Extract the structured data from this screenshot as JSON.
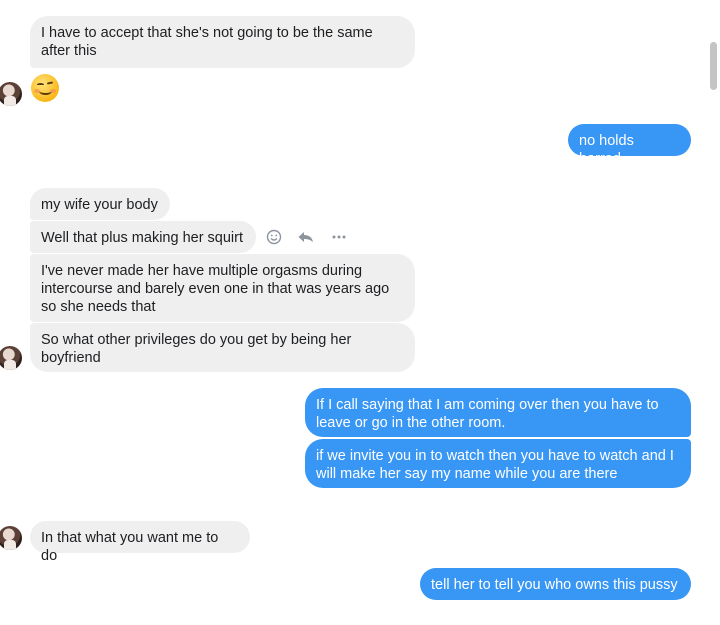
{
  "messages": {
    "m1": "I have to accept that she's not going to be the same\nafter this",
    "m2": "no holds barred",
    "m3": "my wife your body",
    "m4": "Well that plus making her squirt",
    "m5": "I've never made her have multiple orgasms during\nintercourse and barely even one in that was years ago\nso she needs that",
    "m6": "So what other privileges do you get by being her\nboyfriend",
    "m7": "If I call saying that I am coming over then you have to\nleave or go in the other room.",
    "m8": "if we invite you in to watch then you have to watch and I\nwill make her say my name while you are there",
    "m9": "In that what you want me to do",
    "m10": "tell her to tell you who owns this pussy"
  },
  "emoji": "winking-smiling-face",
  "hover_actions": [
    "react-icon",
    "reply-icon",
    "more-icon"
  ],
  "colors": {
    "incoming_bubble": "#efefef",
    "outgoing_bubble": "#3896f5",
    "text_dark": "#1c1e21",
    "icon_gray": "#8d949e"
  }
}
